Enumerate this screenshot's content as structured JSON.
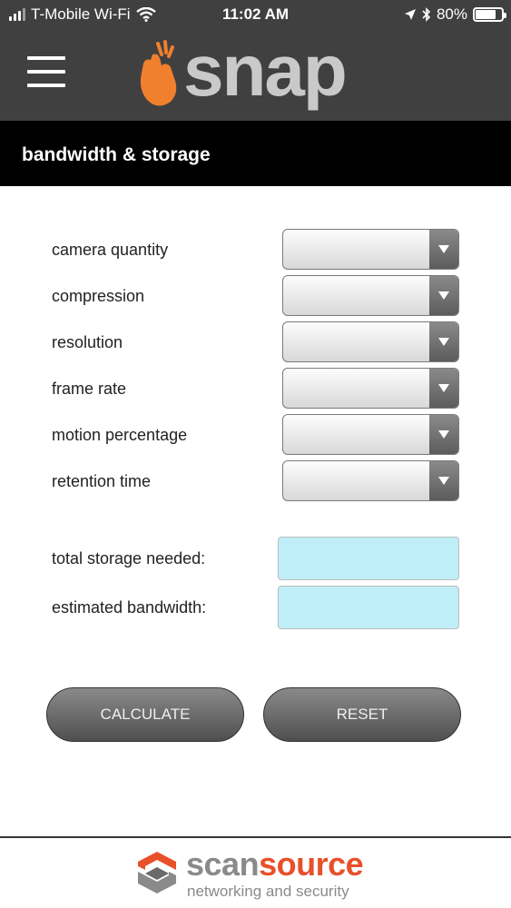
{
  "status_bar": {
    "carrier": "T-Mobile Wi-Fi",
    "time": "11:02 AM",
    "battery": "80%",
    "battery_level": 0.8
  },
  "header": {
    "app_name": "snap",
    "page_title": "bandwidth & storage"
  },
  "form": {
    "fields": [
      {
        "label": "camera quantity",
        "value": ""
      },
      {
        "label": "compression",
        "value": ""
      },
      {
        "label": "resolution",
        "value": ""
      },
      {
        "label": "frame rate",
        "value": ""
      },
      {
        "label": "motion percentage",
        "value": ""
      },
      {
        "label": "retention time",
        "value": ""
      }
    ],
    "outputs": [
      {
        "label": "total storage needed:",
        "value": ""
      },
      {
        "label": "estimated bandwidth:",
        "value": ""
      }
    ]
  },
  "buttons": {
    "calculate": "CALCULATE",
    "reset": "RESET"
  },
  "footer": {
    "brand_part1": "scan",
    "brand_part2": "source",
    "tagline": "networking and security"
  },
  "colors": {
    "header_bg": "#404040",
    "title_bg": "#000000",
    "accent_orange": "#e8502a",
    "output_bg": "#bfeef8"
  },
  "icons": [
    "signal-icon",
    "wifi-icon",
    "location-arrow-icon",
    "bluetooth-icon",
    "battery-icon",
    "hamburger-menu-icon",
    "hand-snap-icon",
    "chevron-down-icon",
    "scansource-logo-icon"
  ]
}
